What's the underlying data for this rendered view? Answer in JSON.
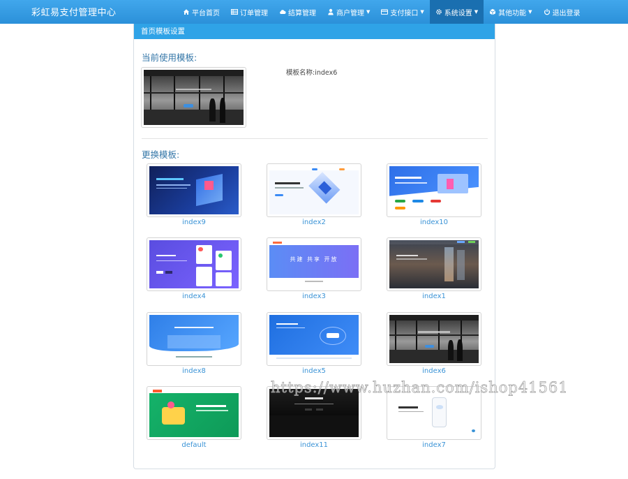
{
  "header": {
    "brand": "彩虹易支付管理中心",
    "nav": [
      {
        "id": "home",
        "label": "平台首页",
        "icon": "home-icon",
        "dropdown": false,
        "active": false
      },
      {
        "id": "orders",
        "label": "订单管理",
        "icon": "list-icon",
        "dropdown": false,
        "active": false
      },
      {
        "id": "settlement",
        "label": "结算管理",
        "icon": "cloud-icon",
        "dropdown": false,
        "active": false
      },
      {
        "id": "merchants",
        "label": "商户管理",
        "icon": "user-icon",
        "dropdown": true,
        "active": false
      },
      {
        "id": "payment",
        "label": "支付接口",
        "icon": "card-icon",
        "dropdown": true,
        "active": false
      },
      {
        "id": "system",
        "label": "系统设置",
        "icon": "gear-icon",
        "dropdown": true,
        "active": true
      },
      {
        "id": "other",
        "label": "其他功能",
        "icon": "cube-icon",
        "dropdown": true,
        "active": false
      },
      {
        "id": "logout",
        "label": "退出登录",
        "icon": "power-icon",
        "dropdown": false,
        "active": false
      }
    ]
  },
  "panel": {
    "title": "首页模板设置",
    "current_title": "当前使用模板:",
    "current_name_label": "模板名称:",
    "current_name": "index6",
    "change_title": "更换模板:"
  },
  "templates": [
    {
      "name": "index9",
      "theme": "dark-blue"
    },
    {
      "name": "index2",
      "theme": "light-iso"
    },
    {
      "name": "index10",
      "theme": "blue-diagonal"
    },
    {
      "name": "index4",
      "theme": "violet-cards"
    },
    {
      "name": "index3",
      "theme": "blue-gradient"
    },
    {
      "name": "index1",
      "theme": "city-blur"
    },
    {
      "name": "index8",
      "theme": "blue-wave"
    },
    {
      "name": "index5",
      "theme": "blue-tech"
    },
    {
      "name": "index6",
      "theme": "bw-photo"
    },
    {
      "name": "default",
      "theme": "green"
    },
    {
      "name": "index11",
      "theme": "black"
    },
    {
      "name": "index7",
      "theme": "white-phone"
    }
  ],
  "template_banner_text": {
    "index3": "共建 共享 开放"
  },
  "colors": {
    "nav_bg": "#2b90d9",
    "nav_active": "#1a6fb0",
    "panel_head": "#2fa3e7",
    "link": "#3a93d6",
    "section_title": "#3577a8"
  },
  "watermark": "https://www.huzhan.com/ishop41561"
}
